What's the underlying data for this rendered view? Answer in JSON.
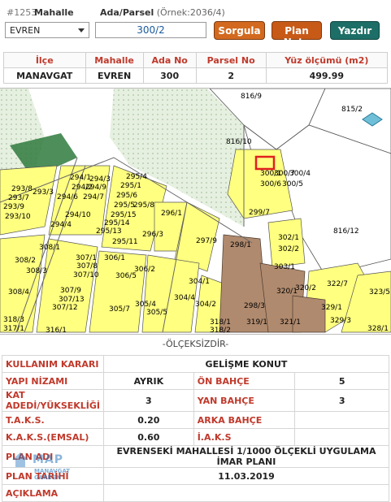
{
  "search": {
    "record_id": "#1253",
    "mahalle_label": "Mahalle",
    "ada_parsel_label": "Ada/Parsel",
    "example_hint": "(Örnek:2036/4)",
    "mahalle_value": "EVREN",
    "parsel_value": "300/2",
    "buttons": {
      "sorgula": "Sorgula",
      "plan_notu": "Plan Notu",
      "yazdir": "Yazdır"
    }
  },
  "summary": {
    "headers": [
      "İlçe",
      "Mahalle",
      "Ada No",
      "Parsel No",
      "Yüz ölçümü (m2)"
    ],
    "values": [
      "MANAVGAT",
      "EVREN",
      "300",
      "2",
      "499.99"
    ]
  },
  "map": {
    "parcel_labels": [
      "816/9",
      "815/2",
      "816/10",
      "300/1",
      "300/7",
      "300/4",
      "300/6",
      "300/5",
      "816/12",
      "299/7",
      "302/1",
      "302/2",
      "303/1",
      "298/1",
      "298/3",
      "319/1",
      "321/1",
      "320/1",
      "320/2",
      "322/7",
      "323/5",
      "329/1",
      "329/3",
      "328/1",
      "295/4",
      "295/1",
      "295/6",
      "295/5",
      "295/8",
      "295/15",
      "295/14",
      "295/13",
      "295/11",
      "296/1",
      "296/3",
      "297/9",
      "294/1",
      "294/2",
      "294/3",
      "294/4",
      "294/6",
      "294/7",
      "294/9",
      "294/10",
      "293/8",
      "293/7",
      "293/9",
      "293/10",
      "293/3",
      "308/1",
      "308/2",
      "308/3",
      "308/4",
      "307/1",
      "307/8",
      "307/9",
      "307/13",
      "307/12",
      "307/10",
      "306/1",
      "306/2",
      "306/5",
      "305/7",
      "305/4",
      "304/1",
      "304/4",
      "304/2",
      "305/5",
      "316/1",
      "318/1",
      "318/2",
      "318/3",
      "317/1"
    ]
  },
  "scale_note": "-ÖLÇEKSİZDİR-",
  "details": {
    "kullanim_karari": {
      "label": "KULLANIM KARARI",
      "value": "GELİŞME KONUT"
    },
    "yapi_nizami": {
      "label": "YAPI NİZAMI",
      "value": "AYRIK"
    },
    "on_bahce": {
      "label": "ÖN BAHÇE",
      "value": "5"
    },
    "kat_adedi": {
      "label": "KAT ADEDİ/YÜKSEKLİĞİ",
      "value": "3"
    },
    "yan_bahce": {
      "label": "YAN BAHÇE",
      "value": "3"
    },
    "taks": {
      "label": "T.A.K.S.",
      "value": "0.20"
    },
    "arka_bahce": {
      "label": "ARKA BAHÇE",
      "value": ""
    },
    "kaks": {
      "label": "K.A.K.S.(EMSAL)",
      "value": "0.60"
    },
    "iaks": {
      "label": "İ.A.K.S",
      "value": ""
    },
    "plan_adi": {
      "label": "PLAN ADI",
      "value": "EVRENSEKİ MAHALLESİ 1/1000 ÖLÇEKLİ UYGULAMA İMAR PLANI"
    },
    "plan_tarihi": {
      "label": "PLAN TARİHİ",
      "value": "11.03.2019"
    },
    "aciklama": {
      "label": "AÇIKLAMA",
      "value": ""
    }
  },
  "watermark": {
    "brand": "MAP",
    "sub": "MANAVGAT GARDEN"
  },
  "colors": {
    "button_orange": "#d2691e",
    "button_teal": "#1d6e66",
    "label_red": "#c0392b",
    "parcel_yellow": "#ffff80",
    "parcel_brown": "#b08a6e",
    "green_area": "#e6f0e0",
    "selected_parcel": "#e02020"
  }
}
